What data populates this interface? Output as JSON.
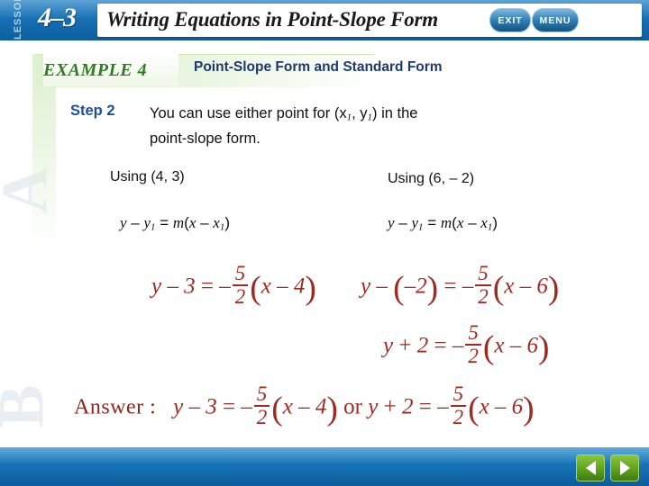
{
  "header": {
    "lesson_label": "LESSON",
    "lesson_number": "4–3",
    "title": "Writing Equations in Point-Slope Form"
  },
  "example": {
    "badge": "EXAMPLE 4",
    "title": "Point-Slope Form and Standard Form"
  },
  "body": {
    "step_label": "Step 2",
    "step_text_line1": "You can use either point for (x",
    "step_sub1": "1",
    "step_text_mid": ", y",
    "step_sub2": "1",
    "step_text_line1_end": ") in the",
    "step_text_line2": "point-slope form.",
    "using_left": "Using (4, 3)",
    "using_right": "Using (6, – 2)",
    "pointslope_left": "y – y1 = m(x – x1)",
    "pointslope_right": "y – y1 = m(x – x1)"
  },
  "math": {
    "left_eq": "y – 3 = – 5/2 (x – 4)",
    "right_eq1": "y – (–2) = – 5/2 (x – 6)",
    "right_eq2": "y + 2 = – 5/2 (x – 6)",
    "answer_word": "Answer :",
    "answer_eq1": "y – 3 = – 5/2 (x – 4)",
    "answer_or": "or",
    "answer_eq2": "y + 2 = – 5/2 (x – 6)",
    "numerator": "5",
    "denominator": "2",
    "math_color": "#9c2b22"
  },
  "decor": {
    "ghost_a": "A",
    "ghost_b": "B"
  },
  "footer": {
    "exit_label": "EXIT",
    "menu_label": "MENU",
    "prev_icon": "triangle-left-icon",
    "next_icon": "triangle-right-icon"
  }
}
